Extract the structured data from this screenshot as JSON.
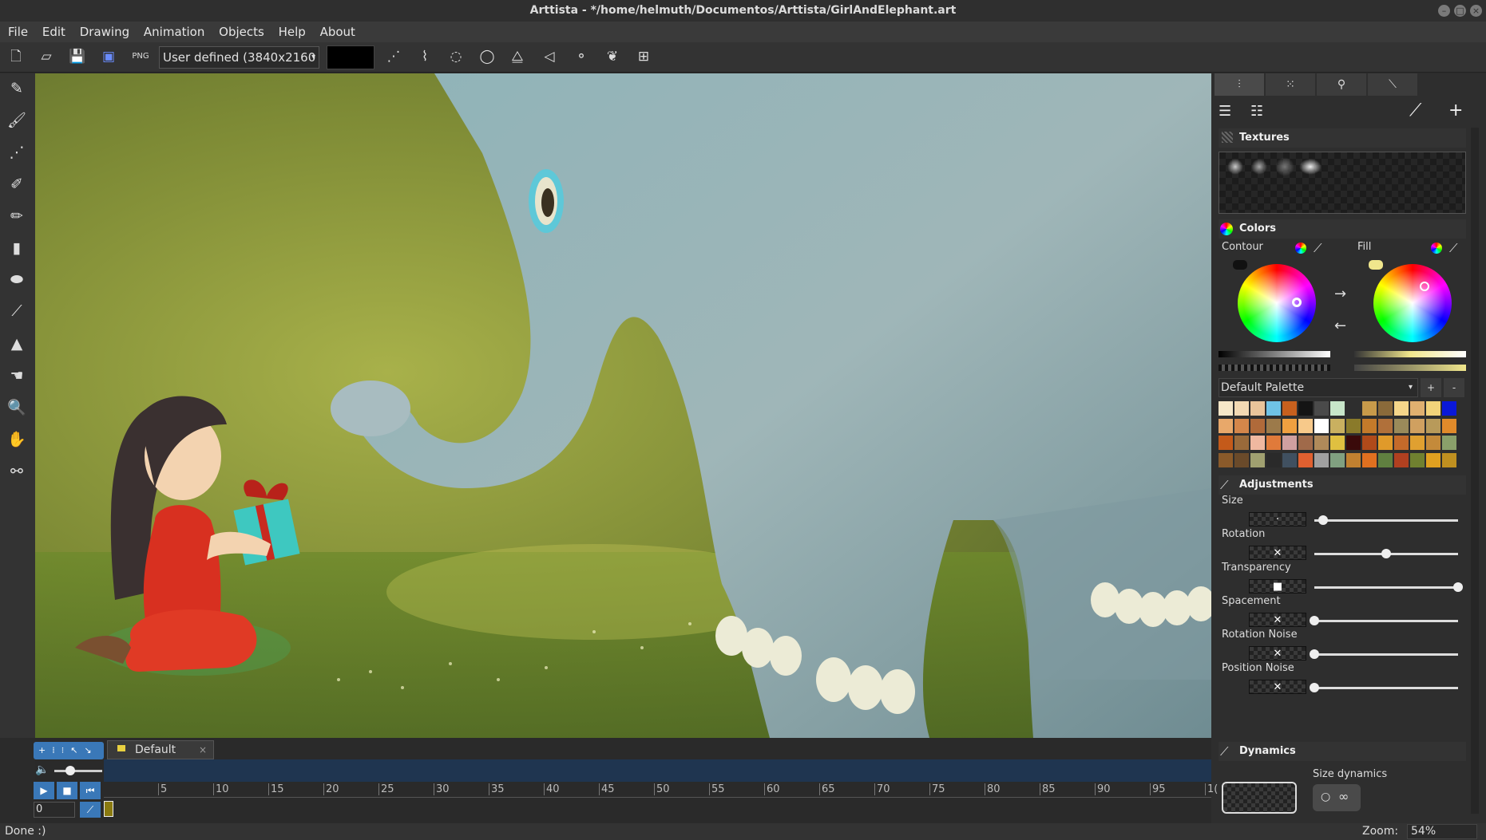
{
  "window": {
    "title": "Arttista - */home/helmuth/Documentos/Arttista/GirlAndElephant.art"
  },
  "menu": [
    "File",
    "Edit",
    "Drawing",
    "Animation",
    "Objects",
    "Help",
    "About"
  ],
  "toolbar": {
    "resolution": "User defined (3840x2160 p",
    "color_swatch": "#000000",
    "icons": [
      "new-file-icon",
      "open-folder-icon",
      "save-icon",
      "save-as-icon",
      "export-png-icon",
      "select-points-icon",
      "select-nodes-icon",
      "lasso-icon",
      "rotate-icon",
      "mirror-icon",
      "perspective-icon",
      "blend-icon",
      "brush-pack-icon",
      "grid-icon"
    ]
  },
  "tools": [
    "pencil-tool-icon",
    "brush-tool-icon",
    "dotted-line-tool-icon",
    "airbrush-tool-icon",
    "marker-tool-icon",
    "eraser-block-icon",
    "eraser-tool-icon",
    "eyedropper-tool-icon",
    "shapes-tool-icon",
    "smudge-tool-icon",
    "zoom-tool-icon",
    "hand-tool-icon",
    "bone-tool-icon"
  ],
  "panel": {
    "textures_title": "Textures",
    "colors_title": "Colors",
    "contour_label": "Contour",
    "fill_label": "Fill",
    "contour_color": "#111111",
    "fill_color": "#f0e68c",
    "palette_name": "Default Palette",
    "palette_add": "+",
    "palette_remove": "-",
    "palette": [
      "#f6e7c8",
      "#f3d9b3",
      "#e9c49a",
      "#6fc3e6",
      "#c7601e",
      "#141414",
      "#4a4a4a",
      "#c8e6c9",
      "#2e2e2e",
      "#c79a4a",
      "#8a6a3a",
      "#f5d68a",
      "#e0b070",
      "#f2d37a",
      "#0a18d8",
      "#e8a86a",
      "#d4864a",
      "#b06a3a",
      "#9c7a4a",
      "#f0a040",
      "#f7c98a",
      "#ffffff",
      "#c9b060",
      "#8a7a2a",
      "#c47a2a",
      "#b0703a",
      "#9a8a5a",
      "#d0a060",
      "#b89a5a",
      "#e08a2a",
      "#c45a1a",
      "#9a6a3a",
      "#f0b8a0",
      "#e07a3a",
      "#d0a0a0",
      "#a06a4a",
      "#b08a5a",
      "#e0c040",
      "#3a0a0a",
      "#b04a1a",
      "#e09a2a",
      "#c46a2a",
      "#e0a030",
      "#c48a3a",
      "#8aa06a",
      "#8a5a2a",
      "#6a4a2a",
      "#a0a070",
      "#2a2a2a",
      "#405060",
      "#e06030",
      "#a0a0a0",
      "#80a080",
      "#c08030",
      "#e07020",
      "#608040",
      "#b04020",
      "#708030",
      "#e0a020",
      "#c09020"
    ],
    "adjustments_title": "Adjustments",
    "adjustments": [
      {
        "label": "Size",
        "value": 0.06,
        "preview": "·"
      },
      {
        "label": "Rotation",
        "value": 0.5,
        "preview": "✕"
      },
      {
        "label": "Transparency",
        "value": 1.0,
        "preview": "■"
      },
      {
        "label": "Spacement",
        "value": 0.0,
        "preview": "✕"
      },
      {
        "label": "Rotation Noise",
        "value": 0.0,
        "preview": "✕"
      },
      {
        "label": "Position Noise",
        "value": 0.0,
        "preview": "✕"
      }
    ],
    "dynamics_title": "Dynamics",
    "size_dynamics_label": "Size dynamics",
    "dynamics_btn1": "○",
    "dynamics_btn2": "∞"
  },
  "timeline": {
    "layer_name": "Default",
    "frame_value": "0",
    "ruler": [
      "5",
      "10",
      "15",
      "20",
      "25",
      "30",
      "35",
      "40",
      "45",
      "50",
      "55",
      "60",
      "65",
      "70",
      "75",
      "80",
      "85",
      "90",
      "95",
      "1("
    ]
  },
  "status": {
    "message": "Done :)",
    "zoom_label": "Zoom:",
    "zoom_value": "54%"
  }
}
